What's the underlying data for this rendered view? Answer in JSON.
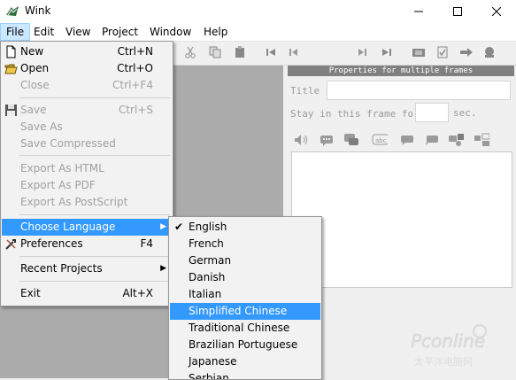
{
  "window": {
    "title": "Wink"
  },
  "menubar": [
    "File",
    "Edit",
    "View",
    "Project",
    "Window",
    "Help"
  ],
  "file_menu": {
    "items": [
      {
        "label": "New",
        "shortcut": "Ctrl+N",
        "icon": "new-document-icon",
        "enabled": true
      },
      {
        "label": "Open",
        "shortcut": "Ctrl+O",
        "icon": "open-folder-icon",
        "enabled": true
      },
      {
        "label": "Close",
        "shortcut": "Ctrl+F4",
        "enabled": false
      },
      {
        "label": "Save",
        "shortcut": "Ctrl+S",
        "icon": "save-disk-icon",
        "enabled": false
      },
      {
        "label": "Save As",
        "enabled": false
      },
      {
        "label": "Save Compressed",
        "enabled": false
      },
      {
        "label": "Export As HTML",
        "enabled": false
      },
      {
        "label": "Export As PDF",
        "enabled": false
      },
      {
        "label": "Export As PostScript",
        "enabled": false
      },
      {
        "label": "Choose Language",
        "submenu": true,
        "highlighted": true
      },
      {
        "label": "Preferences",
        "shortcut": "F4",
        "icon": "tools-icon"
      },
      {
        "label": "Recent Projects",
        "submenu": true
      },
      {
        "label": "Exit",
        "shortcut": "Alt+X"
      }
    ]
  },
  "language_menu": {
    "items": [
      {
        "label": "English",
        "checked": true
      },
      {
        "label": "French"
      },
      {
        "label": "German"
      },
      {
        "label": "Danish"
      },
      {
        "label": "Italian"
      },
      {
        "label": "Simplified Chinese",
        "highlighted": true
      },
      {
        "label": "Traditional Chinese"
      },
      {
        "label": "Brazilian Portuguese"
      },
      {
        "label": "Japanese"
      },
      {
        "label": "Serbian"
      }
    ]
  },
  "properties": {
    "header": "Properties for multiple frames",
    "title_label": "Title",
    "title_value": "",
    "stay_label": "Stay in this frame for",
    "stay_value": "",
    "stay_unit": "sec."
  },
  "watermark": {
    "brand": "Pconline",
    "sub": "太平洋电脑网"
  },
  "colors": {
    "highlight": "#3399ff",
    "active_menu": "#cce8ff",
    "workspace": "#ababab"
  }
}
